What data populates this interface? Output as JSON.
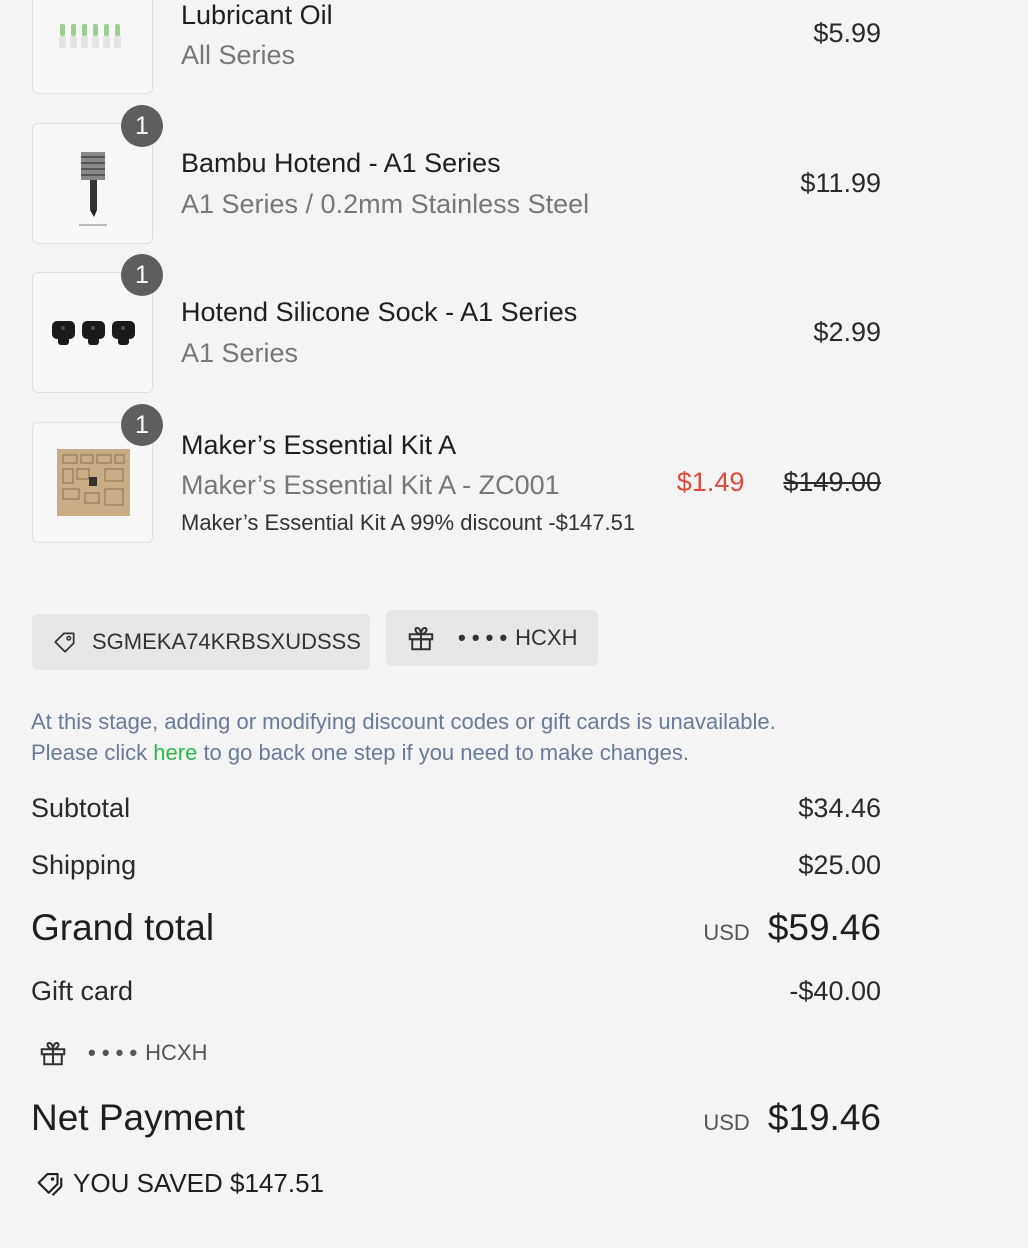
{
  "items": [
    {
      "name": "Lubricant Oil",
      "variant": "All Series",
      "price": "$5.99",
      "qty": null
    },
    {
      "name": "Bambu Hotend - A1 Series",
      "variant": "A1 Series / 0.2mm Stainless Steel",
      "price": "$11.99",
      "qty": "1"
    },
    {
      "name": "Hotend Silicone Sock - A1 Series",
      "variant": "A1 Series",
      "price": "$2.99",
      "qty": "1"
    },
    {
      "name": "Maker’s Essential Kit A",
      "variant": "Maker’s Essential Kit A - ZC001",
      "discount_note": "Maker’s Essential Kit A 99% discount -$147.51",
      "sale_price": "$1.49",
      "original_price": "$149.00",
      "qty": "1"
    }
  ],
  "discount_code": {
    "icon": "tag-icon",
    "code": "SGMEKA74KRBSXUDSSS"
  },
  "gift_card_chip": {
    "icon": "gift-icon",
    "mask": "• • • •",
    "suffix": "HCXH"
  },
  "notice": {
    "line1": "At this stage, adding or modifying discount codes or gift cards is unavailable.",
    "line2_before": "Please click ",
    "link": "here",
    "line2_after": " to go back one step if you need to make changes."
  },
  "summary": {
    "subtotal_label": "Subtotal",
    "subtotal": "$34.46",
    "shipping_label": "Shipping",
    "shipping": "$25.00",
    "grand_total_label": "Grand total",
    "currency": "USD",
    "grand_total": "$59.46",
    "gift_card_label": "Gift card",
    "gift_card_amount": "-$40.00",
    "gift_card_mask": "• • • •",
    "gift_card_suffix": "HCXH",
    "net_payment_label": "Net Payment",
    "net_payment": "$19.46",
    "saved_text": "YOU SAVED $147.51"
  },
  "colors": {
    "sale": "#e14a3b",
    "link": "#2db84e",
    "notice": "#6a7a99",
    "badge": "#5e5e5e"
  }
}
